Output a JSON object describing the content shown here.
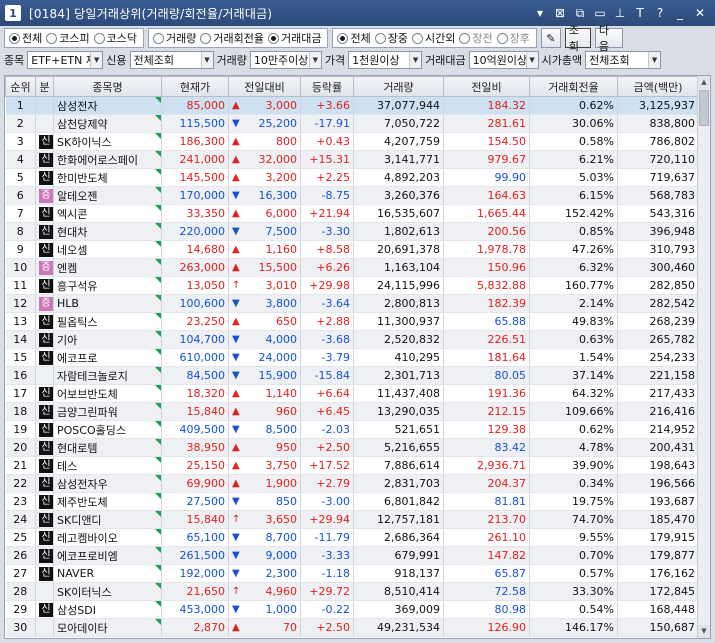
{
  "window": {
    "number": "1",
    "title": "[0184] 당일거래상위(거래량/회전율/거래대금)"
  },
  "market_filter": [
    {
      "label": "전체",
      "selected": true
    },
    {
      "label": "코스피",
      "selected": false
    },
    {
      "label": "코스닥",
      "selected": false
    }
  ],
  "sort_filter": [
    {
      "label": "거래량",
      "selected": false
    },
    {
      "label": "거래회전율",
      "selected": false
    },
    {
      "label": "거래대금",
      "selected": true
    }
  ],
  "session_filter": [
    {
      "label": "전체",
      "selected": true
    },
    {
      "label": "장중",
      "selected": false
    },
    {
      "label": "시간외",
      "selected": false
    },
    {
      "label": "장전",
      "selected": false,
      "dim": true
    },
    {
      "label": "장후",
      "selected": false,
      "dim": true
    }
  ],
  "buttons": {
    "query": "조회",
    "next": "다음"
  },
  "filters": {
    "stock_label": "종목",
    "stock_value": "ETF+ETN 제",
    "credit_label": "신용",
    "credit_value": "전체조회",
    "volume_label": "거래량",
    "volume_value": "10만주이상",
    "price_label": "가격",
    "price_value": "1천원이상",
    "amount_label": "거래대금",
    "amount_value": "10억원이상",
    "cap_label": "시가총액",
    "cap_value": "전체조회"
  },
  "columns": [
    "순위",
    "분",
    "종목명",
    "현재가",
    "전일대비",
    "등락률",
    "거래량",
    "전일비",
    "거래회전율",
    "금액(백만)"
  ],
  "rows": [
    {
      "rank": "1",
      "mark": "",
      "name": "삼성전자",
      "price": "85,000",
      "dir": "up",
      "change": "3,000",
      "rate": "+3.66",
      "volume": "37,077,944",
      "prev": "184.32",
      "turnover": "0.62%",
      "amount": "3,125,937"
    },
    {
      "rank": "2",
      "mark": "",
      "name": "삼천당제약",
      "price": "115,500",
      "dir": "down",
      "change": "25,200",
      "rate": "-17.91",
      "volume": "7,050,722",
      "prev": "281.61",
      "turnover": "30.06%",
      "amount": "838,800"
    },
    {
      "rank": "3",
      "mark": "신",
      "name": "SK하이닉스",
      "price": "186,300",
      "dir": "up",
      "change": "800",
      "rate": "+0.43",
      "volume": "4,207,759",
      "prev": "154.50",
      "turnover": "0.58%",
      "amount": "786,802"
    },
    {
      "rank": "4",
      "mark": "신",
      "name": "한화에어로스페이",
      "price": "241,000",
      "dir": "up",
      "change": "32,000",
      "rate": "+15.31",
      "volume": "3,141,771",
      "prev": "979.67",
      "turnover": "6.21%",
      "amount": "720,110"
    },
    {
      "rank": "5",
      "mark": "신",
      "name": "한미반도체",
      "price": "145,500",
      "dir": "up",
      "change": "3,200",
      "rate": "+2.25",
      "volume": "4,892,203",
      "prev": "99.90",
      "turnover": "5.03%",
      "amount": "719,637"
    },
    {
      "rank": "6",
      "mark": "증",
      "name": "알테오젠",
      "price": "170,000",
      "dir": "down",
      "change": "16,300",
      "rate": "-8.75",
      "volume": "3,260,376",
      "prev": "164.63",
      "turnover": "6.15%",
      "amount": "568,783"
    },
    {
      "rank": "7",
      "mark": "신",
      "name": "엑시콘",
      "price": "33,350",
      "dir": "up",
      "change": "6,000",
      "rate": "+21.94",
      "volume": "16,535,607",
      "prev": "1,665.44",
      "turnover": "152.42%",
      "amount": "543,316"
    },
    {
      "rank": "8",
      "mark": "신",
      "name": "현대차",
      "price": "220,000",
      "dir": "down",
      "change": "7,500",
      "rate": "-3.30",
      "volume": "1,802,613",
      "prev": "200.56",
      "turnover": "0.85%",
      "amount": "396,948"
    },
    {
      "rank": "9",
      "mark": "신",
      "name": "네오셈",
      "price": "14,680",
      "dir": "up",
      "change": "1,160",
      "rate": "+8.58",
      "volume": "20,691,378",
      "prev": "1,978.78",
      "turnover": "47.26%",
      "amount": "310,793"
    },
    {
      "rank": "10",
      "mark": "증",
      "name": "엔켐",
      "price": "263,000",
      "dir": "up",
      "change": "15,500",
      "rate": "+6.26",
      "volume": "1,163,104",
      "prev": "150.96",
      "turnover": "6.32%",
      "amount": "300,460"
    },
    {
      "rank": "11",
      "mark": "신",
      "name": "흥구석유",
      "price": "13,050",
      "dir": "upper",
      "change": "3,010",
      "rate": "+29.98",
      "volume": "24,115,996",
      "prev": "5,832.88",
      "turnover": "160.77%",
      "amount": "282,850"
    },
    {
      "rank": "12",
      "mark": "증",
      "name": "HLB",
      "price": "100,600",
      "dir": "down",
      "change": "3,800",
      "rate": "-3.64",
      "volume": "2,800,813",
      "prev": "182.39",
      "turnover": "2.14%",
      "amount": "282,542"
    },
    {
      "rank": "13",
      "mark": "신",
      "name": "필옵틱스",
      "price": "23,250",
      "dir": "up",
      "change": "650",
      "rate": "+2.88",
      "volume": "11,300,937",
      "prev": "65.88",
      "turnover": "49.83%",
      "amount": "268,239"
    },
    {
      "rank": "14",
      "mark": "신",
      "name": "기아",
      "price": "104,700",
      "dir": "down",
      "change": "4,000",
      "rate": "-3.68",
      "volume": "2,520,832",
      "prev": "226.51",
      "turnover": "0.63%",
      "amount": "265,782"
    },
    {
      "rank": "15",
      "mark": "신",
      "name": "에코프로",
      "price": "610,000",
      "dir": "down",
      "change": "24,000",
      "rate": "-3.79",
      "volume": "410,295",
      "prev": "181.64",
      "turnover": "1.54%",
      "amount": "254,233"
    },
    {
      "rank": "16",
      "mark": "",
      "name": "자람테크놀로지",
      "price": "84,500",
      "dir": "down",
      "change": "15,900",
      "rate": "-15.84",
      "volume": "2,301,713",
      "prev": "80.05",
      "turnover": "37.14%",
      "amount": "221,158"
    },
    {
      "rank": "17",
      "mark": "신",
      "name": "어보브반도체",
      "price": "18,320",
      "dir": "up",
      "change": "1,140",
      "rate": "+6.64",
      "volume": "11,437,408",
      "prev": "191.36",
      "turnover": "64.32%",
      "amount": "217,433"
    },
    {
      "rank": "18",
      "mark": "신",
      "name": "금양그린파워",
      "price": "15,840",
      "dir": "up",
      "change": "960",
      "rate": "+6.45",
      "volume": "13,290,035",
      "prev": "212.15",
      "turnover": "109.66%",
      "amount": "216,416"
    },
    {
      "rank": "19",
      "mark": "신",
      "name": "POSCO홀딩스",
      "price": "409,500",
      "dir": "down",
      "change": "8,500",
      "rate": "-2.03",
      "volume": "521,651",
      "prev": "129.38",
      "turnover": "0.62%",
      "amount": "214,952"
    },
    {
      "rank": "20",
      "mark": "신",
      "name": "현대로템",
      "price": "38,950",
      "dir": "up",
      "change": "950",
      "rate": "+2.50",
      "volume": "5,216,655",
      "prev": "83.42",
      "turnover": "4.78%",
      "amount": "200,431"
    },
    {
      "rank": "21",
      "mark": "신",
      "name": "테스",
      "price": "25,150",
      "dir": "up",
      "change": "3,750",
      "rate": "+17.52",
      "volume": "7,886,614",
      "prev": "2,936.71",
      "turnover": "39.90%",
      "amount": "198,643"
    },
    {
      "rank": "22",
      "mark": "신",
      "name": "삼성전자우",
      "price": "69,900",
      "dir": "up",
      "change": "1,900",
      "rate": "+2.79",
      "volume": "2,831,703",
      "prev": "204.37",
      "turnover": "0.34%",
      "amount": "196,566"
    },
    {
      "rank": "23",
      "mark": "신",
      "name": "제주반도체",
      "price": "27,500",
      "dir": "down",
      "change": "850",
      "rate": "-3.00",
      "volume": "6,801,842",
      "prev": "81.81",
      "turnover": "19.75%",
      "amount": "193,687"
    },
    {
      "rank": "24",
      "mark": "신",
      "name": "SK디앤디",
      "price": "15,840",
      "dir": "upper",
      "change": "3,650",
      "rate": "+29.94",
      "volume": "12,757,181",
      "prev": "213.70",
      "turnover": "74.70%",
      "amount": "185,470"
    },
    {
      "rank": "25",
      "mark": "신",
      "name": "레고켐바이오",
      "price": "65,100",
      "dir": "down",
      "change": "8,700",
      "rate": "-11.79",
      "volume": "2,686,364",
      "prev": "261.10",
      "turnover": "9.55%",
      "amount": "179,915"
    },
    {
      "rank": "26",
      "mark": "신",
      "name": "에코프로비엠",
      "price": "261,500",
      "dir": "down",
      "change": "9,000",
      "rate": "-3.33",
      "volume": "679,991",
      "prev": "147.82",
      "turnover": "0.70%",
      "amount": "179,877"
    },
    {
      "rank": "27",
      "mark": "신",
      "name": "NAVER",
      "price": "192,000",
      "dir": "down",
      "change": "2,300",
      "rate": "-1.18",
      "volume": "918,137",
      "prev": "65.87",
      "turnover": "0.57%",
      "amount": "176,162"
    },
    {
      "rank": "28",
      "mark": "",
      "name": "SK이터닉스",
      "price": "21,650",
      "dir": "upper",
      "change": "4,960",
      "rate": "+29.72",
      "volume": "8,510,414",
      "prev": "72.58",
      "turnover": "33.30%",
      "amount": "172,845"
    },
    {
      "rank": "29",
      "mark": "신",
      "name": "삼성SDI",
      "price": "453,000",
      "dir": "down",
      "change": "1,000",
      "rate": "-0.22",
      "volume": "369,009",
      "prev": "80.98",
      "turnover": "0.54%",
      "amount": "168,448"
    },
    {
      "rank": "30",
      "mark": "",
      "name": "모아데이타",
      "price": "2,870",
      "dir": "up",
      "change": "70",
      "rate": "+2.50",
      "volume": "49,231,534",
      "prev": "126.90",
      "turnover": "146.17%",
      "amount": "150,687"
    }
  ],
  "colors": {
    "up": "#e0201f",
    "down": "#1452d6",
    "titlebar": "#2c4a7a",
    "selected_row": "#cde1f3"
  }
}
